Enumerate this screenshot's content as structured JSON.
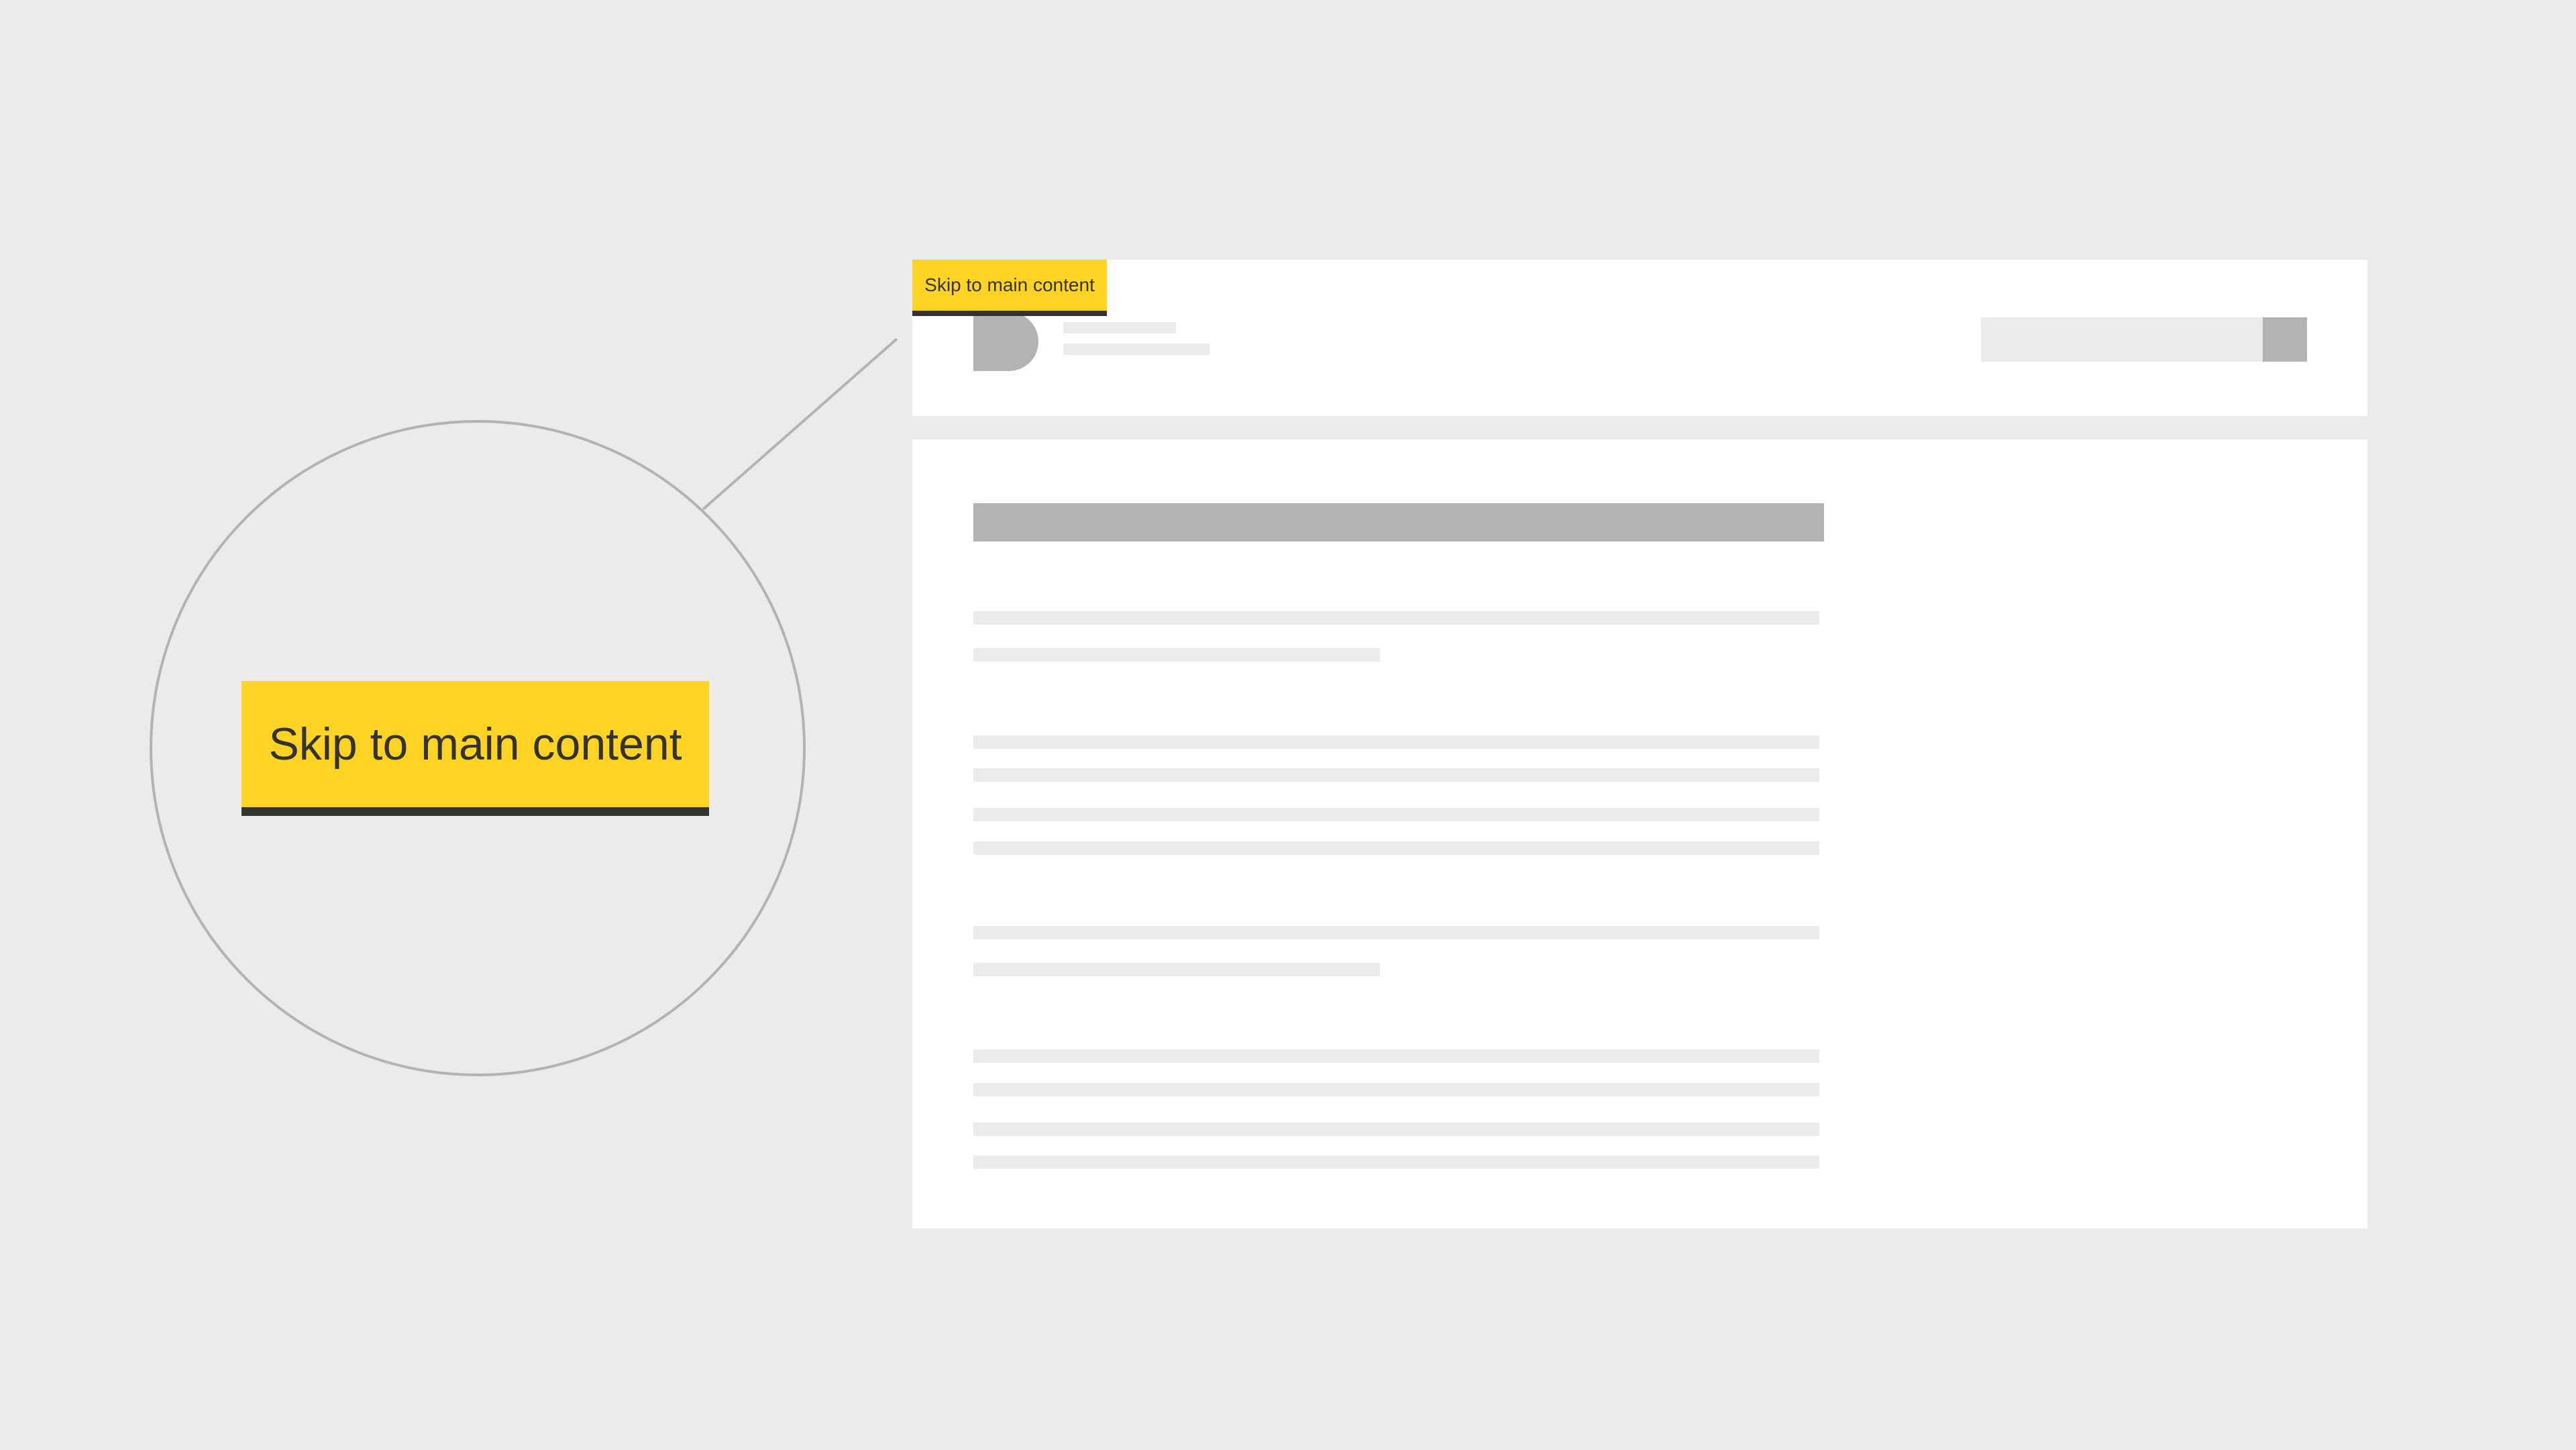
{
  "skip_link": {
    "label": "Skip to main content"
  },
  "callout": {
    "label": "Skip to main content"
  },
  "colors": {
    "background": "#ebebeb",
    "panel": "#ffffff",
    "placeholder_dark": "#b3b3b3",
    "placeholder_light": "#ebebeb",
    "skip_link_background": "#fed324",
    "skip_link_border": "#333333",
    "skip_link_text": "#333333",
    "callout_stroke": "#b3b3b3"
  },
  "icons": {
    "logo": "logo-icon",
    "search_submit": "search-button"
  }
}
